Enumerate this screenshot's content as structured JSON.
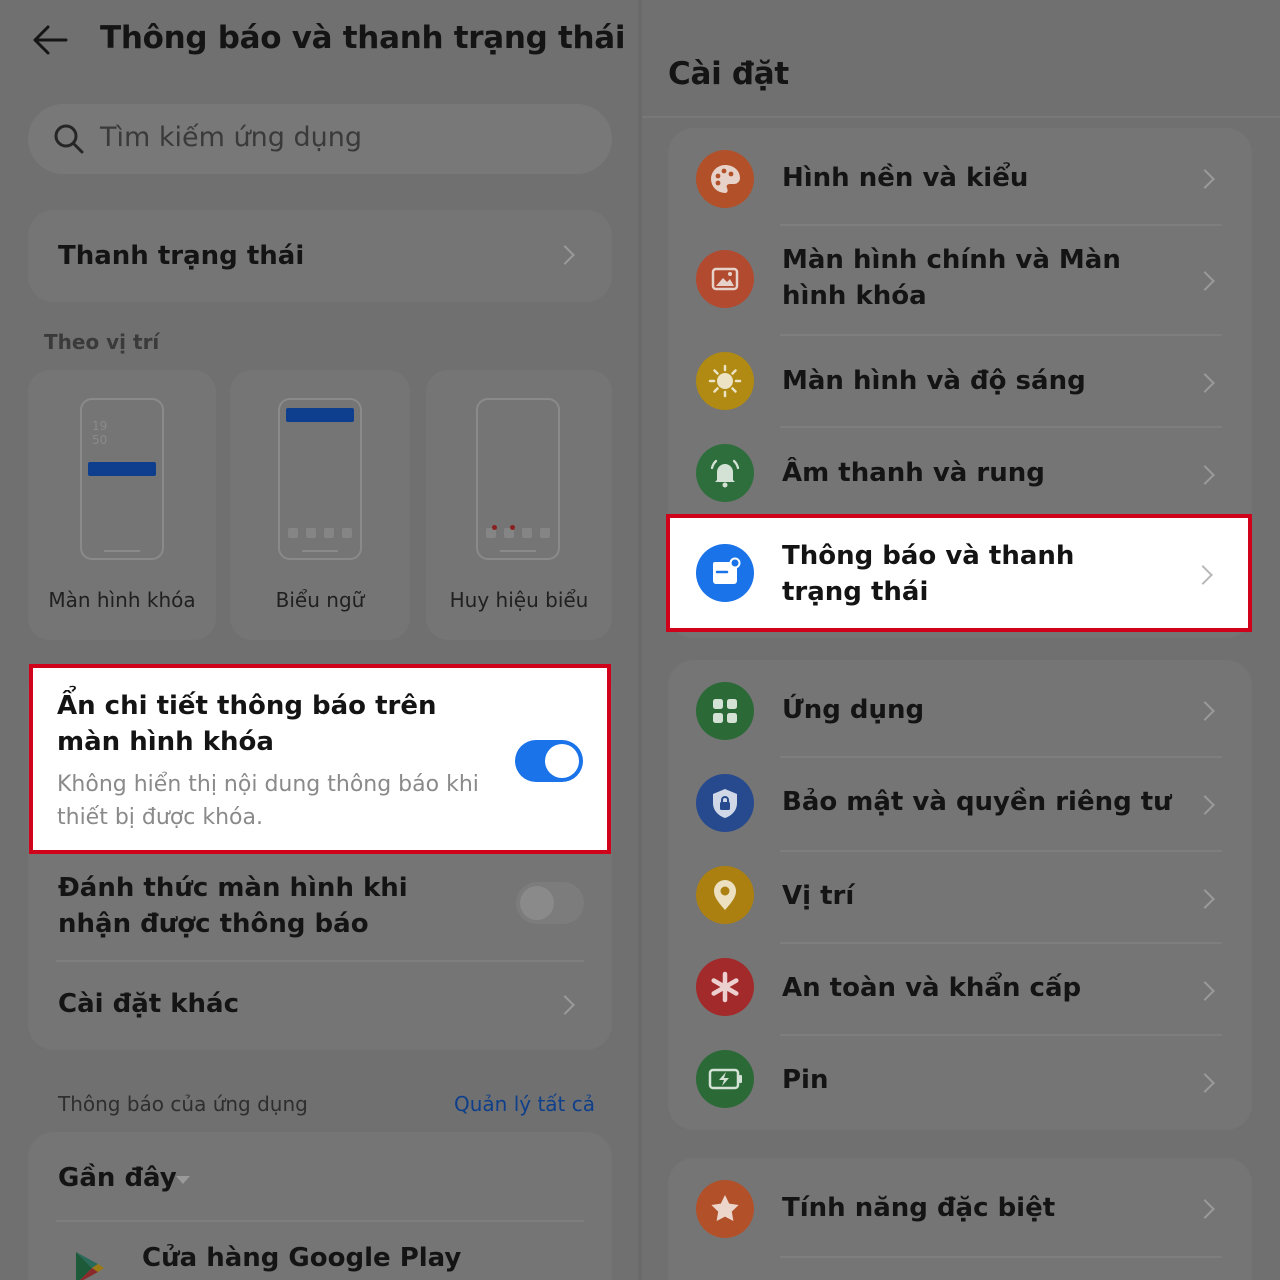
{
  "left": {
    "header_title": "Thông báo và thanh trạng thái",
    "search_placeholder": "Tìm kiếm ứng dụng",
    "status_bar_item": "Thanh trạng thái",
    "section_by_position": "Theo vị trí",
    "tiles": [
      {
        "label": "Màn hình khóa",
        "clock_hour": "19",
        "clock_min": "50"
      },
      {
        "label": "Biểu ngữ"
      },
      {
        "label": "Huy hiệu biểu"
      }
    ],
    "hide_details": {
      "title": "Ẩn chi tiết thông báo trên màn hình khóa",
      "description": "Không hiển thị nội dung thông báo khi thiết bị được khóa.",
      "enabled": true
    },
    "wake_screen": {
      "title": "Đánh thức màn hình khi nhận được thông báo",
      "enabled": false
    },
    "other_settings": "Cài đặt khác",
    "app_notifications_label": "Thông báo của ứng dụng",
    "manage_all": "Quản lý tất cả",
    "recent_label": "Gần đây",
    "first_app": "Cửa hàng Google Play"
  },
  "right": {
    "title": "Cài đặt",
    "group1": [
      {
        "label": "Hình nền và kiểu",
        "icon": "palette-icon",
        "color": "#b2502a"
      },
      {
        "label": "Màn hình chính và Màn hình khóa",
        "icon": "picture-icon",
        "color": "#b24a30"
      },
      {
        "label": "Màn hình và độ sáng",
        "icon": "sun-icon",
        "color": "#b08a12"
      },
      {
        "label": "Âm thanh và rung",
        "icon": "bell-icon",
        "color": "#2e6e3c"
      },
      {
        "label": "Thông báo và thanh trạng thái",
        "icon": "notification-icon",
        "color": "#1a73e8"
      }
    ],
    "group2": [
      {
        "label": "Ứng dụng",
        "icon": "apps-grid-icon",
        "color": "#2b6a36"
      },
      {
        "label": "Bảo mật và quyền riêng tư",
        "icon": "shield-lock-icon",
        "color": "#274a8e"
      },
      {
        "label": "Vị trí",
        "icon": "location-pin-icon",
        "color": "#ab8010"
      },
      {
        "label": "An toàn và khẩn cấp",
        "icon": "asterisk-icon",
        "color": "#a22a2a"
      },
      {
        "label": "Pin",
        "icon": "battery-icon",
        "color": "#2b6a36"
      }
    ],
    "group3": [
      {
        "label": "Tính năng đặc biệt",
        "icon": "star-icon",
        "color": "#b2502a"
      }
    ]
  },
  "colors": {
    "accent": "#1a73e8",
    "highlight_border": "#d0021b",
    "dim_background": "#707070"
  }
}
